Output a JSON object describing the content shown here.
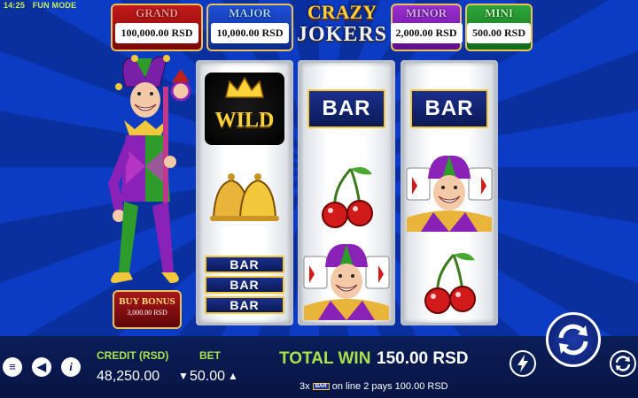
{
  "status": {
    "time": "14:25",
    "mode": "FUN MODE"
  },
  "jackpots": {
    "grand": {
      "title": "GRAND",
      "amount": "100,000.00 RSD"
    },
    "major": {
      "title": "MAJOR",
      "amount": "10,000.00 RSD"
    },
    "minor": {
      "title": "MINOR",
      "amount": "2,000.00 RSD"
    },
    "mini": {
      "title": "MINI",
      "amount": "500.00 RSD"
    }
  },
  "logo": {
    "line1": "CRAZY",
    "line2": "JOKERS"
  },
  "buy_bonus": {
    "title": "BUY BONUS",
    "price": "3,000.00 RSD"
  },
  "reels": {
    "reel1": {
      "wild": "WILD",
      "bar_labels": [
        "BAR",
        "BAR",
        "BAR"
      ]
    },
    "reel2": {
      "bar_label": "BAR"
    },
    "reel3": {
      "bar_label": "BAR"
    }
  },
  "symbols": [
    "wild-symbol",
    "bells-symbol",
    "triple-bar-symbol",
    "bar-symbol",
    "cherry-symbol",
    "joker-symbol"
  ],
  "bottom": {
    "credit_label": "CREDIT (RSD)",
    "credit_value": "48,250.00",
    "bet_label": "BET",
    "bet_value": "50.00",
    "total_win_label": "TOTAL WIN",
    "total_win_value": "150.00 RSD",
    "line_info_prefix": "3x",
    "line_info_bar": "BAR",
    "line_info_suffix": "on line 2 pays 100.00 RSD"
  },
  "colors": {
    "accent_green": "#a8e34a",
    "background_blue": "#0d3cc4",
    "gold": "#f2c73c"
  }
}
